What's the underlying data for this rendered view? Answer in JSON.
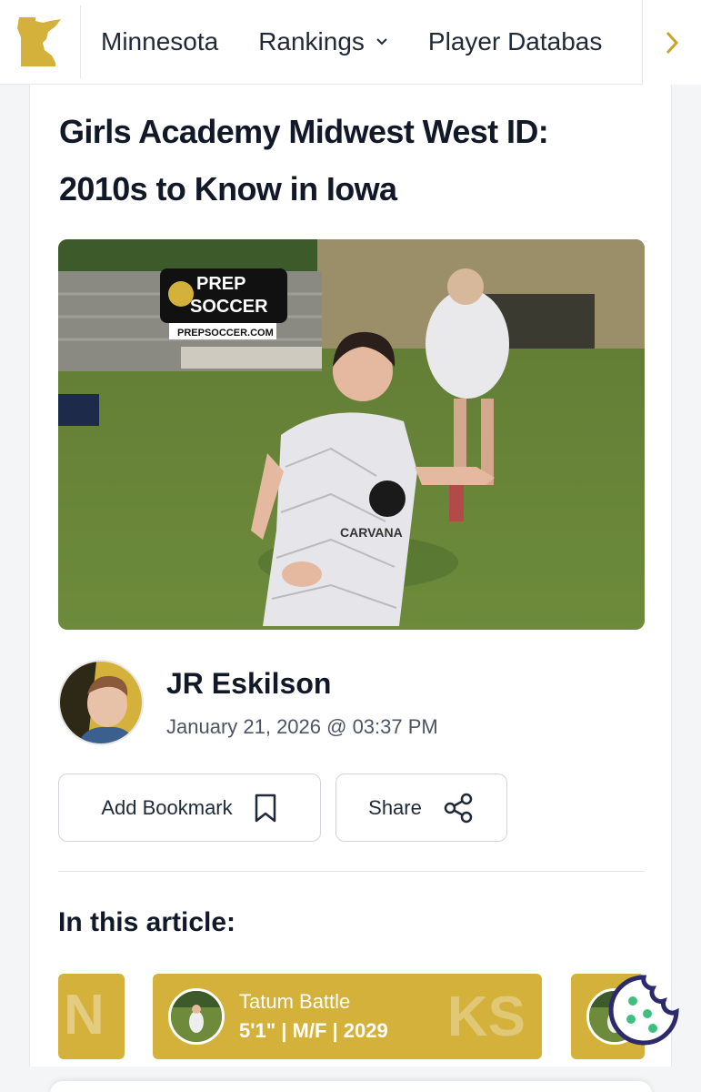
{
  "nav": {
    "state_logo": "minnesota-state-logo",
    "items": [
      {
        "label": "Minnesota",
        "has_dropdown": false
      },
      {
        "label": "Rankings",
        "has_dropdown": true
      },
      {
        "label": "Player Databas",
        "has_dropdown": false
      }
    ],
    "scroll_icon": "chevron-right-icon"
  },
  "article": {
    "title": "Girls Academy Midwest West ID: 2010s to Know in Iowa",
    "hero_logo": {
      "line1": "PREP",
      "line2": "SOCCER",
      "site": "PREPSOCCER.COM"
    },
    "jersey_text": "CARVANA",
    "author": {
      "name": "JR Eskilson",
      "date": "January 21, 2026 @ 03:37 PM"
    },
    "actions": {
      "bookmark_label": "Add Bookmark",
      "bookmark_icon": "bookmark-icon",
      "share_label": "Share",
      "share_icon": "share-icon"
    },
    "in_article": {
      "title": "In this article:",
      "chips": [
        {
          "ghost": "N"
        },
        {
          "name": "Tatum Battle",
          "info": "5'1\" | M/F | 2029",
          "ghost": "KS"
        },
        {
          "ghost": ""
        }
      ]
    }
  },
  "colors": {
    "gold": "#d4b13b",
    "accent_chevron": "#c9a227",
    "cookie": "#2c2a6b"
  }
}
